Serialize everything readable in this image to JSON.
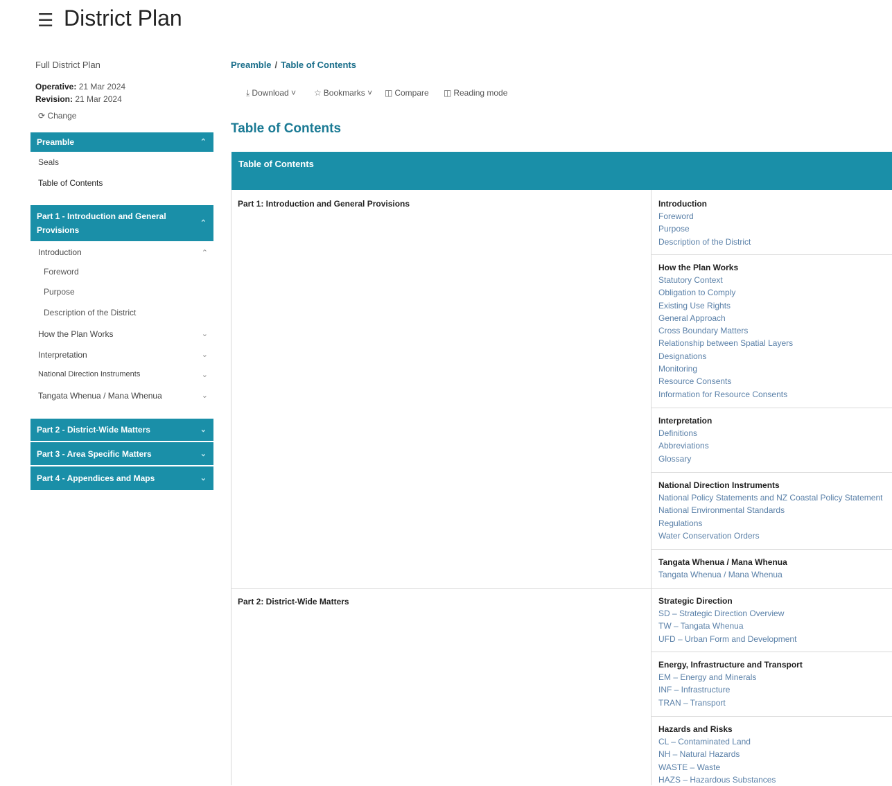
{
  "app": {
    "title": "District Plan",
    "menu_icon": "hamburger-menu-icon"
  },
  "sidebar": {
    "plan_name": "Full District Plan",
    "operative_label": "Operative:",
    "operative_date": "21 Mar 2024",
    "revision_label": "Revision:",
    "revision_date": "21 Mar 2024",
    "change_label": "Change",
    "change_icon": "refresh-icon",
    "sections": [
      {
        "label": "Preamble",
        "expanded": true
      },
      {
        "label": "Part 1 - Introduction and General Provisions",
        "expanded": true
      },
      {
        "label": "Part 2 - District-Wide Matters",
        "expanded": false
      },
      {
        "label": "Part 3 - Area Specific Matters",
        "expanded": false
      },
      {
        "label": "Part 4 - Appendices and Maps",
        "expanded": false
      }
    ],
    "preamble_items": [
      "Seals",
      "Table of Contents"
    ],
    "part1_items": [
      {
        "label": "Introduction",
        "expanded": true
      },
      {
        "label": "Foreword"
      },
      {
        "label": "Purpose"
      },
      {
        "label": "Description of the District"
      },
      {
        "label": "How the Plan Works",
        "expanded": false
      },
      {
        "label": "Interpretation",
        "expanded": false
      },
      {
        "label": "National Direction Instruments",
        "expanded": false
      },
      {
        "label": "Tangata Whenua / Mana Whenua",
        "expanded": false
      }
    ]
  },
  "breadcrumb": {
    "items": [
      "Preamble",
      "Table of Contents"
    ],
    "separator": "/"
  },
  "toolbar": {
    "download": "Download",
    "bookmarks": "Bookmarks",
    "compare": "Compare",
    "reading_mode": "Reading mode"
  },
  "page_title": "Table of Contents",
  "toc": {
    "header": "Table of Contents",
    "parts": [
      {
        "label": "Part 1: Introduction and General Provisions",
        "groups": [
          {
            "title": "Introduction",
            "links": [
              "Foreword",
              "Purpose",
              "Description of the District"
            ]
          },
          {
            "title": "How the Plan Works",
            "links": [
              "Statutory Context",
              "Obligation to Comply",
              "Existing Use Rights",
              "General Approach",
              "Cross Boundary Matters",
              "Relationship between Spatial Layers",
              "Designations",
              "Monitoring",
              "Resource Consents",
              "Information for Resource Consents"
            ]
          },
          {
            "title": "Interpretation",
            "links": [
              "Definitions",
              "Abbreviations",
              "Glossary"
            ]
          },
          {
            "title": "National Direction Instruments",
            "links": [
              "National Policy Statements and NZ Coastal Policy Statement",
              "National Environmental Standards",
              "Regulations",
              "Water Conservation Orders"
            ]
          },
          {
            "title": "Tangata Whenua / Mana Whenua",
            "links": [
              "Tangata Whenua / Mana Whenua"
            ]
          }
        ]
      },
      {
        "label": "Part 2: District-Wide Matters",
        "groups": [
          {
            "title": "Strategic Direction",
            "links": [
              "SD – Strategic Direction Overview",
              "TW – Tangata Whenua",
              "UFD – Urban Form and Development"
            ]
          },
          {
            "title": "Energy, Infrastructure and Transport",
            "links": [
              "EM – Energy and Minerals",
              "INF – Infrastructure",
              "TRAN – Transport"
            ]
          },
          {
            "title": "Hazards and Risks",
            "links": [
              "CL – Contaminated Land",
              "NH – Natural Hazards",
              "WASTE – Waste",
              "HAZS – Hazardous Substances"
            ]
          }
        ]
      }
    ]
  }
}
